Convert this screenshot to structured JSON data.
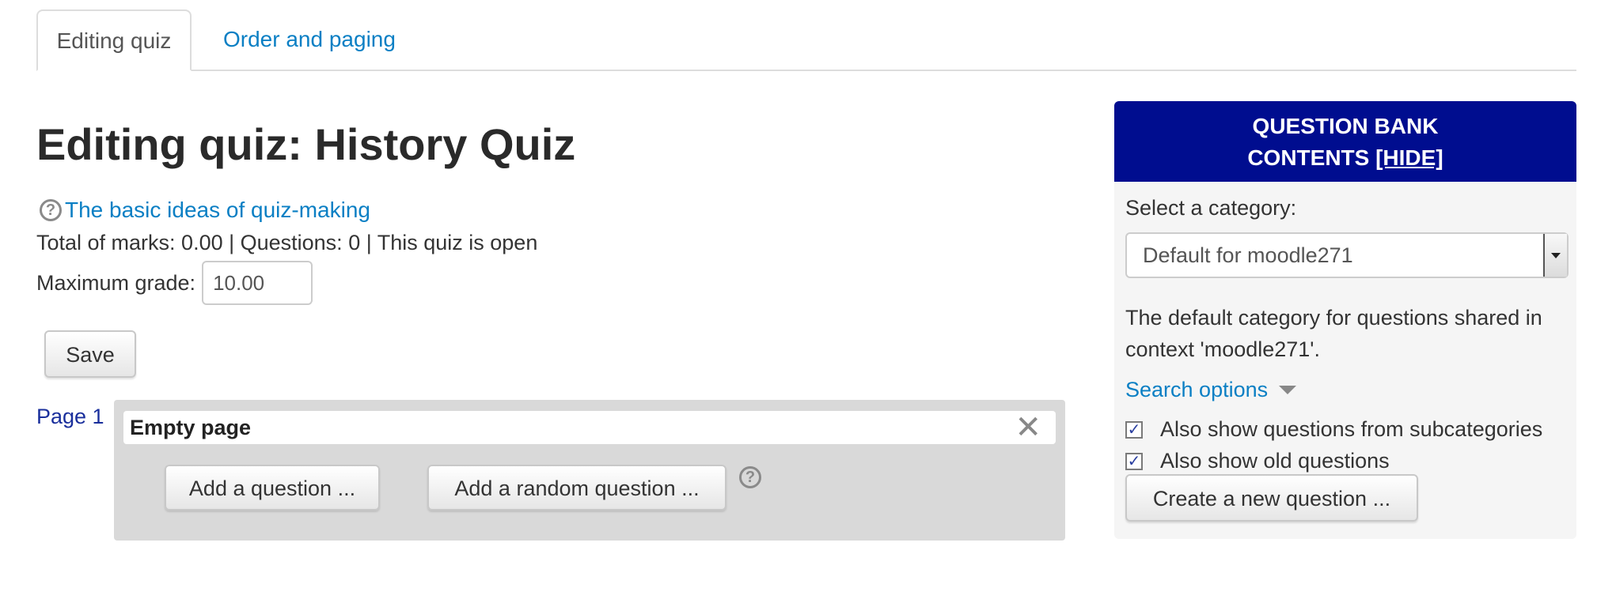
{
  "tabs": {
    "editing": "Editing quiz",
    "order": "Order and paging"
  },
  "page": {
    "title": "Editing quiz: History Quiz",
    "help_link": "The basic ideas of quiz-making",
    "summary": "Total of marks: 0.00 | Questions: 0 | This quiz is open",
    "max_grade_label": "Maximum grade:",
    "max_grade_value": "10.00",
    "save_label": "Save"
  },
  "page_section": {
    "page_label": "Page 1",
    "header": "Empty page",
    "close_glyph": "✕",
    "add_question": "Add a question ...",
    "add_random": "Add a random question ..."
  },
  "question_bank": {
    "title_line1": "QUESTION BANK",
    "title_line2": "CONTENTS ",
    "hide_link": "[HIDE]",
    "category_label": "Select a category:",
    "category_value": "Default for moodle271",
    "description": "The default category for questions shared in context 'moodle271'.",
    "search_options": "Search options",
    "check_subcategories": "Also show questions from subcategories",
    "check_old": "Also show old questions",
    "create_button": "Create a new question ..."
  },
  "colors": {
    "link": "#0a7fc4",
    "bank_header": "#000d8f"
  },
  "icons": {
    "help": "question-circle-icon",
    "close": "close-icon",
    "dropdown": "chevron-down-icon",
    "checkbox": "checkmark-icon"
  }
}
